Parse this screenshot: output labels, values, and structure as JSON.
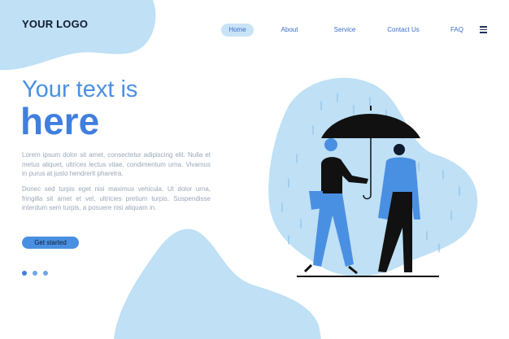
{
  "brand": {
    "logo_text": "YOUR LOGO"
  },
  "nav": {
    "items": [
      {
        "label": "Home",
        "active": true
      },
      {
        "label": "About",
        "active": false
      },
      {
        "label": "Service",
        "active": false
      },
      {
        "label": "Contact Us",
        "active": false
      },
      {
        "label": "FAQ",
        "active": false
      }
    ],
    "menu_icon": "hamburger-menu-icon"
  },
  "hero": {
    "title_line1": "Your text is",
    "title_line2": "here",
    "paragraph1": "Lorem ipsum dolor sit amet, consectetur adipiscing elit. Nulla et metus aliquet, ultrices lectus vitae, condimentum urna. Vivamus in purus at justo hendrerit pharetra.",
    "paragraph2": "Donec sed turpis eget nisi maximus vehicula. Ut dolor urna, fringilla sit amet et vel, ultricies pretium turpis. Suspendisse interdum sem turpis, a posuere nisi aliquam in.",
    "cta_label": "Get started",
    "pagination": {
      "count": 3,
      "active_index": 0
    }
  },
  "colors": {
    "accent": "#4a90e2",
    "accent_dark": "#3f7fde",
    "blob": "#bfe0f5",
    "text_dark": "#0f1b2d",
    "body_text": "#9aa7b8"
  },
  "illustration": {
    "subject": "two people walking under a black umbrella in the rain",
    "icons": [
      "umbrella-icon",
      "rain-icon"
    ]
  }
}
